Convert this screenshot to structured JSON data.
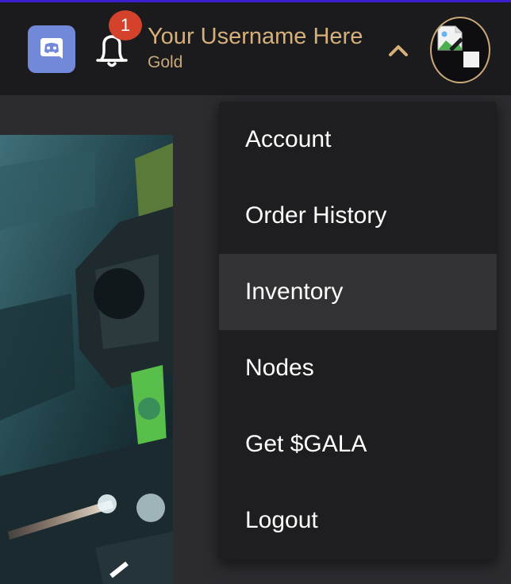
{
  "header": {
    "notification_count": "1",
    "username": "Your Username Here",
    "tier": "Gold"
  },
  "menu": {
    "items": [
      {
        "label": "Account"
      },
      {
        "label": "Order History"
      },
      {
        "label": "Inventory"
      },
      {
        "label": "Nodes"
      },
      {
        "label": "Get $GALA"
      },
      {
        "label": "Logout"
      }
    ],
    "highlighted": "Inventory"
  },
  "icons": {
    "discord": "discord-icon",
    "bell": "bell-icon",
    "chevron": "chevron-up-icon",
    "avatar": "broken-image-icon"
  },
  "colors": {
    "accent_gold": "#d6b07a",
    "badge_red": "#d4422c",
    "discord_blue": "#7289da",
    "header_bg": "#1b1b1d",
    "menu_bg": "#1e1e20",
    "menu_highlight": "#323234"
  }
}
